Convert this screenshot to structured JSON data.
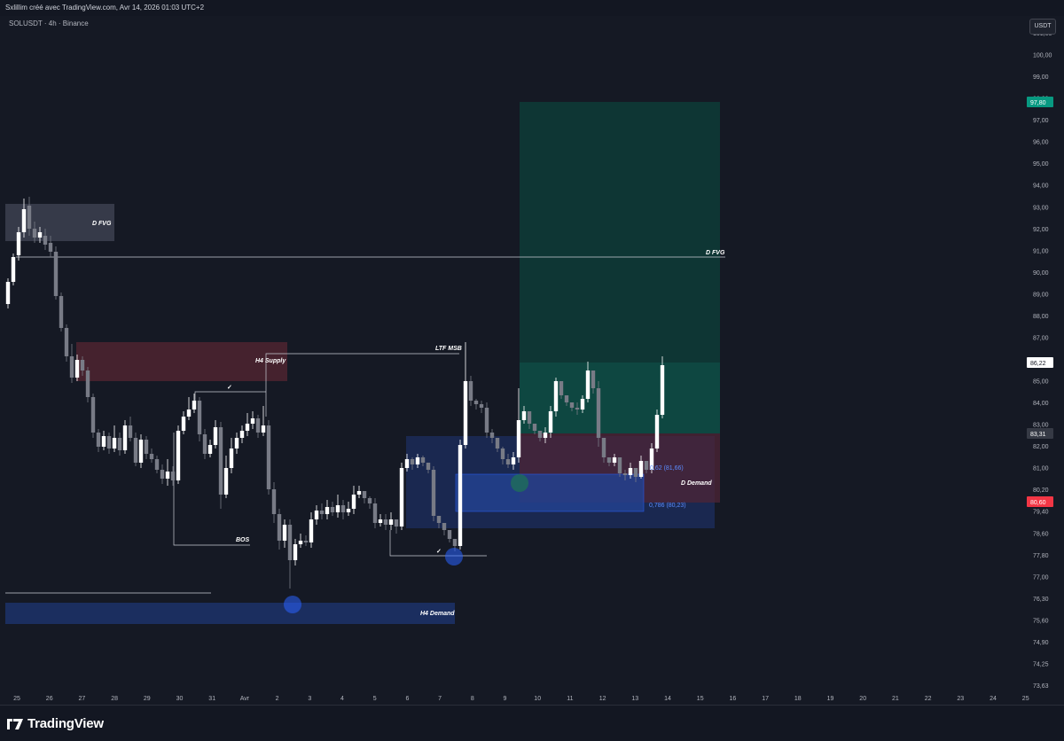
{
  "header": {
    "caption": "Sxlillim créé avec TradingView.com, Avr 14, 2026 01:03 UTC+2",
    "symbol": "SOLUSDT · 4h · Binance",
    "currency_button": "USDT"
  },
  "price_axis": {
    "labels": [
      "101,00",
      "100,00",
      "99,00",
      "98,00",
      "97,00",
      "96,00",
      "95,00",
      "94,00",
      "93,00",
      "92,00",
      "91,00",
      "90,00",
      "89,00",
      "88,00",
      "87,00",
      "86,00",
      "85,00",
      "84,00",
      "83,00",
      "82,00",
      "81,00",
      "80,20",
      "79,40",
      "78,60",
      "77,80",
      "77,00",
      "76,30",
      "75,60",
      "74,90",
      "74,25",
      "73,63"
    ],
    "tags": [
      {
        "label": "97,80",
        "color": "#089981"
      },
      {
        "label": "86,22",
        "color": "#ffffff"
      },
      {
        "label": "83,31",
        "color": "#363a45"
      },
      {
        "label": "80,60",
        "color": "#f23645"
      }
    ]
  },
  "time_axis": {
    "labels": [
      "25",
      "26",
      "27",
      "28",
      "29",
      "30",
      "31",
      "Avr",
      "2",
      "3",
      "4",
      "5",
      "6",
      "7",
      "8",
      "9",
      "10",
      "11",
      "12",
      "13",
      "14",
      "15",
      "16",
      "17",
      "18",
      "19",
      "20",
      "21",
      "22",
      "23",
      "24",
      "25"
    ]
  },
  "annotations": {
    "d_fvg_left": "D FVG",
    "d_fvg_right": "D FVG",
    "h4_supply": "H4 Supply",
    "ltf_msb": "LTF MSB",
    "bos": "BOS",
    "check_1": "✓",
    "check_2": "✓",
    "h4_demand": "H4 Demand",
    "d_demand": "D Demand",
    "fib_62": "0,62 (81,66)",
    "fib_786": "0,786 (80,23)"
  },
  "colors": {
    "background": "#131722",
    "bull_candle": "#ffffff",
    "bear_candle": "#787b86",
    "target_zone": "#089981",
    "supply_zone": "#f23645",
    "demand_zone": "#2962ff"
  },
  "footer": {
    "brand": "TradingView"
  }
}
